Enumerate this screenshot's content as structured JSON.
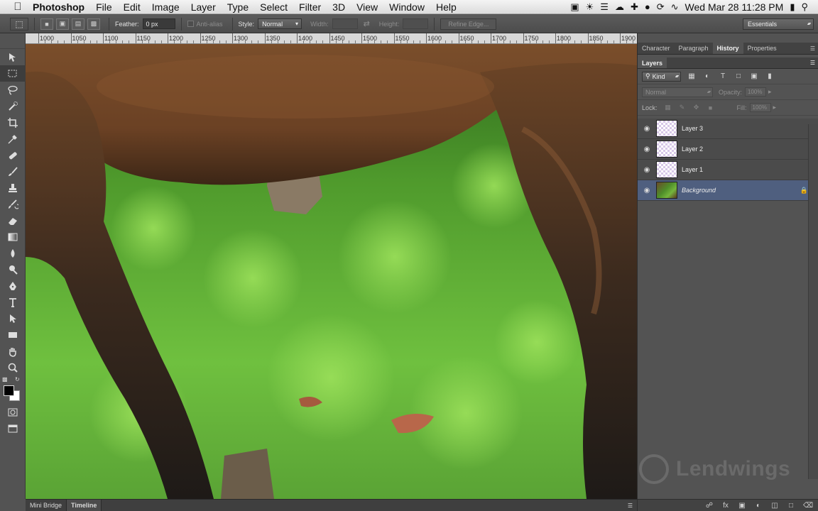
{
  "menubar": {
    "app_name": "Photoshop",
    "items": [
      "File",
      "Edit",
      "Image",
      "Layer",
      "Type",
      "Select",
      "Filter",
      "3D",
      "View",
      "Window",
      "Help"
    ],
    "clock": "Wed Mar 28  11:28 PM"
  },
  "options": {
    "feather_label": "Feather:",
    "feather_value": "0 px",
    "antialias_label": "Anti-alias",
    "style_label": "Style:",
    "style_value": "Normal",
    "width_label": "Width:",
    "height_label": "Height:",
    "refine_label": "Refine Edge...",
    "workspace": "Essentials"
  },
  "ruler": {
    "labels": [
      "1000",
      "1050",
      "1100",
      "1150",
      "1200",
      "1250",
      "1300",
      "1350",
      "1400",
      "1450",
      "1500",
      "1550",
      "1600",
      "1650",
      "1700",
      "1750",
      "1800",
      "1850",
      "1900"
    ]
  },
  "bottom_tabs": [
    "Mini Bridge",
    "Timeline"
  ],
  "panels": {
    "top_tabs": [
      "Character",
      "Paragraph",
      "History",
      "Properties"
    ],
    "active_top_tab": "History",
    "layers_tab": "Layers",
    "kind_label": "Kind",
    "blend_mode": "Normal",
    "opacity_label": "Opacity:",
    "opacity_value": "100%",
    "lock_label": "Lock:",
    "fill_label": "Fill:",
    "fill_value": "100%"
  },
  "layers": [
    {
      "name": "Layer 3",
      "selected": false
    },
    {
      "name": "Layer 2",
      "selected": false
    },
    {
      "name": "Layer 1",
      "selected": false
    },
    {
      "name": "Background",
      "selected": true
    }
  ],
  "watermark": "Lendwings",
  "colors": {
    "selected_layer": "#4f5f7f",
    "panel_bg": "#535353"
  }
}
